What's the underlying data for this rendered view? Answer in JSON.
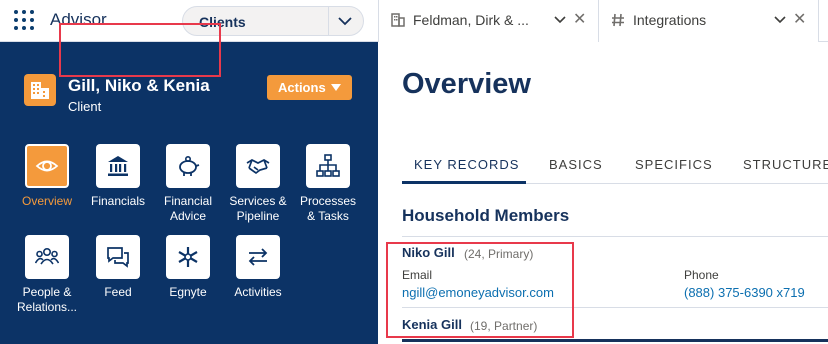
{
  "app": {
    "name": "Advisor"
  },
  "nav_select": {
    "value": "Clients"
  },
  "workspace_tabs": [
    {
      "label": "Feldman, Dirk & ...",
      "icon": "building-icon"
    },
    {
      "label": "Integrations",
      "icon": "hashtag-icon"
    }
  ],
  "record": {
    "title": "Gill, Niko & Kenia",
    "subtitle": "Client",
    "actions_label": "Actions"
  },
  "nav_tiles": [
    {
      "label": "Overview",
      "icon": "eye-icon",
      "active": true
    },
    {
      "label": "Financials",
      "icon": "bank-icon"
    },
    {
      "label": "Financial\nAdvice",
      "icon": "piggy-bank-icon"
    },
    {
      "label": "Services &\nPipeline",
      "icon": "handshake-icon"
    },
    {
      "label": "Processes\n& Tasks",
      "icon": "hierarchy-icon"
    },
    {
      "label": "People &\nRelations...",
      "icon": "people-icon"
    },
    {
      "label": "Feed",
      "icon": "chat-icon"
    },
    {
      "label": "Egnyte",
      "icon": "egnyte-icon"
    },
    {
      "label": "Activities",
      "icon": "swap-arrows-icon"
    }
  ],
  "main": {
    "title": "Overview",
    "tabs": [
      "KEY RECORDS",
      "BASICS",
      "SPECIFICS",
      "STRUCTURE"
    ],
    "active_tab": "KEY RECORDS",
    "section_title": "Household Members",
    "members": [
      {
        "name": "Niko Gill",
        "role": "(24, Primary)",
        "email_label": "Email",
        "email": "ngill@emoneyadvisor.com",
        "phone_label": "Phone",
        "phone": "(888) 375-6390 x719"
      },
      {
        "name": "Kenia Gill",
        "role": "(19, Partner)"
      }
    ]
  },
  "colors": {
    "panel": "#0c3366",
    "accent": "#f49a3c",
    "highlight": "#e8394b",
    "link": "#0c6fb0"
  }
}
